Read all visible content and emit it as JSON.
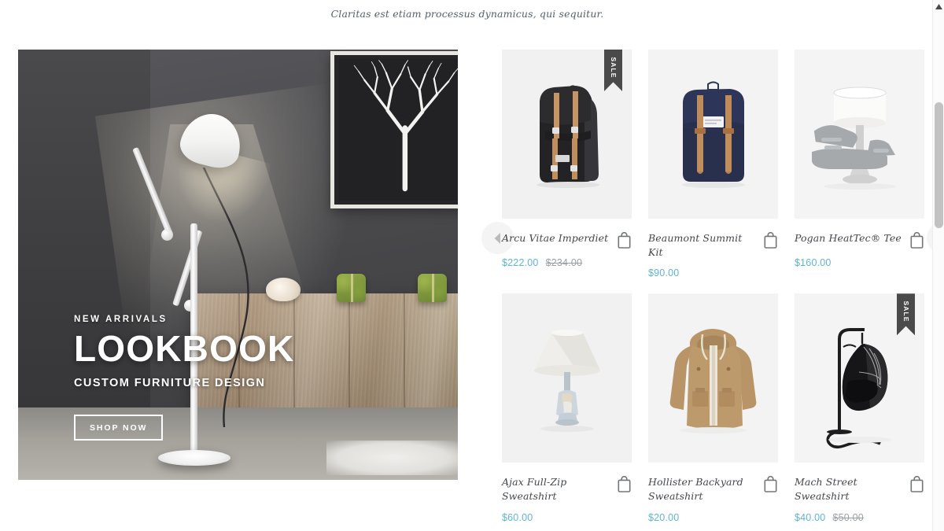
{
  "announcement": {
    "text": "Claritas est etiam processus dynamicus, qui sequitur."
  },
  "hero": {
    "eyebrow": "NEW ARRIVALS",
    "title": "LOOKBOOK",
    "subtitle": "CUSTOM FURNITURE DESIGN",
    "cta_label": "SHOP NOW",
    "alt": "Styled room with white task floor lamp, wooden sideboard and framed tree artwork"
  },
  "carousel": {
    "prev_label": "Previous products",
    "next_label": "Next products"
  },
  "colors": {
    "price": "#5fb4d8",
    "price_old": "#9aa1a6",
    "title": "#44474b",
    "badge_bg": "#4a4a4a",
    "announcement_text": "#54616c"
  },
  "badges": {
    "sale": "SALE"
  },
  "icons": {
    "bag": "shopping-bag-icon",
    "arrow_left": "chevron-left-icon",
    "arrow_right": "chevron-right-icon",
    "scroll_up": "scroll-up-arrow-icon"
  },
  "products": [
    {
      "title": "Arcu Vitae Imperdiet",
      "price": "$222.00",
      "price_old": "$234.00",
      "on_sale": true,
      "art": "black-backpack",
      "bg": "light"
    },
    {
      "title": "Beaumont Summit Kit",
      "price": "$90.00",
      "price_old": "",
      "on_sale": false,
      "art": "navy-backpack",
      "bg": "pale"
    },
    {
      "title": "Pogan HeatTec® Tee",
      "price": "$160.00",
      "price_old": "",
      "on_sale": false,
      "art": "lamp-sandals",
      "bg": "white"
    },
    {
      "title": "Ajax Full-Zip Sweatshirt",
      "price": "$60.00",
      "price_old": "",
      "on_sale": false,
      "art": "table-lamp",
      "bg": "light"
    },
    {
      "title": "Hollister Backyard Sweatshirt",
      "price": "$20.00",
      "price_old": "",
      "on_sale": false,
      "art": "tan-jacket",
      "bg": "pale"
    },
    {
      "title": "Mach Street Sweatshirt",
      "price": "$40.00",
      "price_old": "$50.00",
      "on_sale": true,
      "art": "hanging-chair",
      "bg": "white"
    }
  ]
}
